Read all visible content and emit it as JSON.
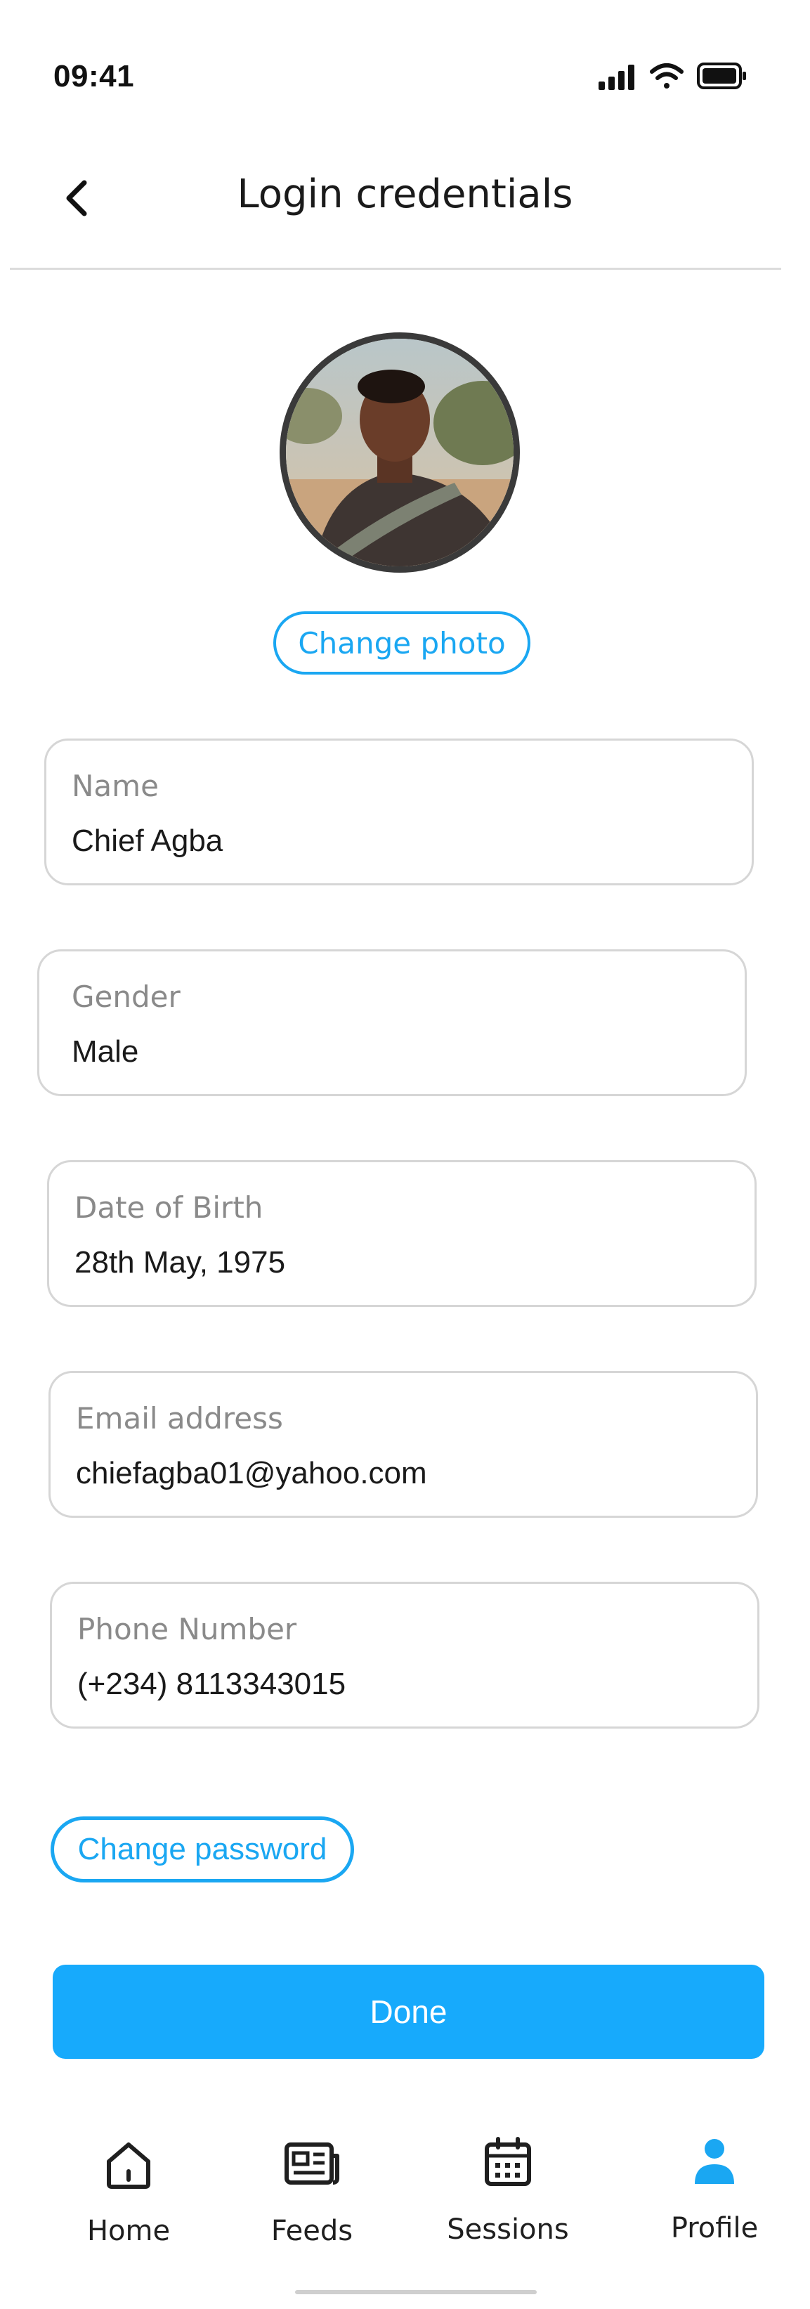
{
  "status_bar": {
    "time": "09:41"
  },
  "header": {
    "title": "Login credentials"
  },
  "profile": {
    "change_photo_label": "Change photo"
  },
  "fields": {
    "name": {
      "label": "Name",
      "value": "Chief Agba"
    },
    "gender": {
      "label": "Gender",
      "value": "Male"
    },
    "dob": {
      "label": "Date of Birth",
      "value": "28th May, 1975"
    },
    "email": {
      "label": "Email address",
      "value": "chiefagba01@yahoo.com"
    },
    "phone": {
      "label": "Phone Number",
      "value": "(+234) 8113343015"
    }
  },
  "actions": {
    "change_password_label": "Change password",
    "done_label": "Done"
  },
  "bottom_nav": {
    "items": [
      {
        "label": "Home",
        "icon": "home-icon"
      },
      {
        "label": "Feeds",
        "icon": "feeds-icon"
      },
      {
        "label": "Sessions",
        "icon": "calendar-icon"
      },
      {
        "label": "Profile",
        "icon": "profile-icon"
      }
    ],
    "active": "Profile"
  },
  "colors": {
    "accent": "#1aa7f2",
    "done_button": "#17aafc",
    "active_nav": "#1aa7f2"
  }
}
